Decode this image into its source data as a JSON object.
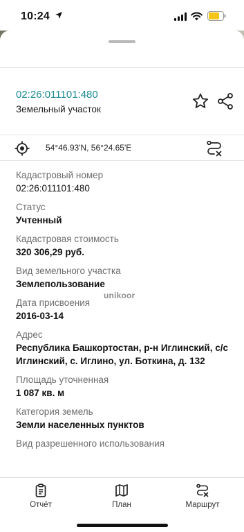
{
  "status_bar": {
    "time": "10:24"
  },
  "sheet": {
    "title": "02:26:011101:480",
    "subtitle": "Земельный участок",
    "coordinates": "54°46.93'N, 56°24.65'E"
  },
  "fields": [
    {
      "label": "Кадастровый номер",
      "value": "02:26:011101:480",
      "bold": false
    },
    {
      "label": "Статус",
      "value": "Учтенный",
      "bold": true
    },
    {
      "label": "Кадастровая стоимость",
      "value": "320 306,29 руб.",
      "bold": true
    },
    {
      "label": "Вид земельного участка",
      "value": "Землепользование",
      "bold": true
    },
    {
      "label": "Дата присвоения",
      "value": "2016-03-14",
      "bold": true
    },
    {
      "label": "Адрес",
      "value": "Республика Башкортостан, р-н Иглинский, с/с Иглинский, с. Иглино, ул. Боткина, д. 132",
      "bold": true
    },
    {
      "label": "Площадь уточненная",
      "value": "1 087 кв. м",
      "bold": true
    },
    {
      "label": "Категория земель",
      "value": "Земли населенных пунктов",
      "bold": true
    },
    {
      "label": "Вид разрешенного использования",
      "value": "",
      "bold": true
    }
  ],
  "watermark": "unikoor",
  "tabbar": {
    "report": "Отчёт",
    "plan": "План",
    "route": "Маршрут"
  },
  "colors": {
    "accent": "#1d8a92",
    "battery": "#f5c518"
  },
  "icons": {
    "favorite": "star-icon",
    "share": "share-icon",
    "locate": "crosshair-icon",
    "route_clear": "route-clear-icon",
    "report": "clipboard-icon",
    "plan": "map-icon",
    "route": "route-icon"
  }
}
